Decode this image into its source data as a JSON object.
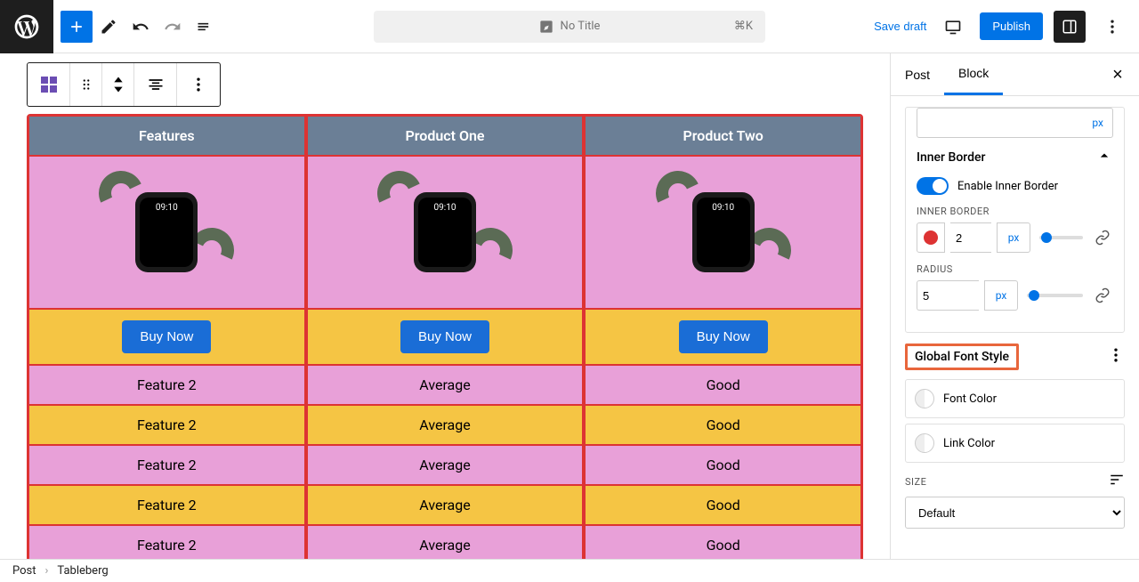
{
  "topbar": {
    "title": "No Title",
    "shortcut": "⌘K",
    "save_draft": "Save draft",
    "publish": "Publish"
  },
  "sidebar": {
    "tabs": {
      "post": "Post",
      "block": "Block"
    },
    "inner_border": {
      "title": "Inner Border",
      "enable_label": "Enable Inner Border",
      "border_label": "INNER BORDER",
      "border_value": "2",
      "border_unit": "px",
      "border_color": "#d33",
      "radius_label": "RADIUS",
      "radius_value": "5",
      "radius_unit": "px"
    },
    "global_font": {
      "title": "Global Font Style",
      "font_color": "Font Color",
      "link_color": "Link Color",
      "size_label": "SIZE",
      "size_value": "Default"
    }
  },
  "table": {
    "headers": [
      "Features",
      "Product One",
      "Product Two"
    ],
    "buy_label": "Buy Now",
    "rows": [
      [
        "Feature 2",
        "Average",
        "Good"
      ],
      [
        "Feature 2",
        "Average",
        "Good"
      ],
      [
        "Feature 2",
        "Average",
        "Good"
      ],
      [
        "Feature 2",
        "Average",
        "Good"
      ],
      [
        "Feature 2",
        "Average",
        "Good"
      ]
    ]
  },
  "breadcrumb": {
    "post": "Post",
    "block": "Tableberg"
  }
}
